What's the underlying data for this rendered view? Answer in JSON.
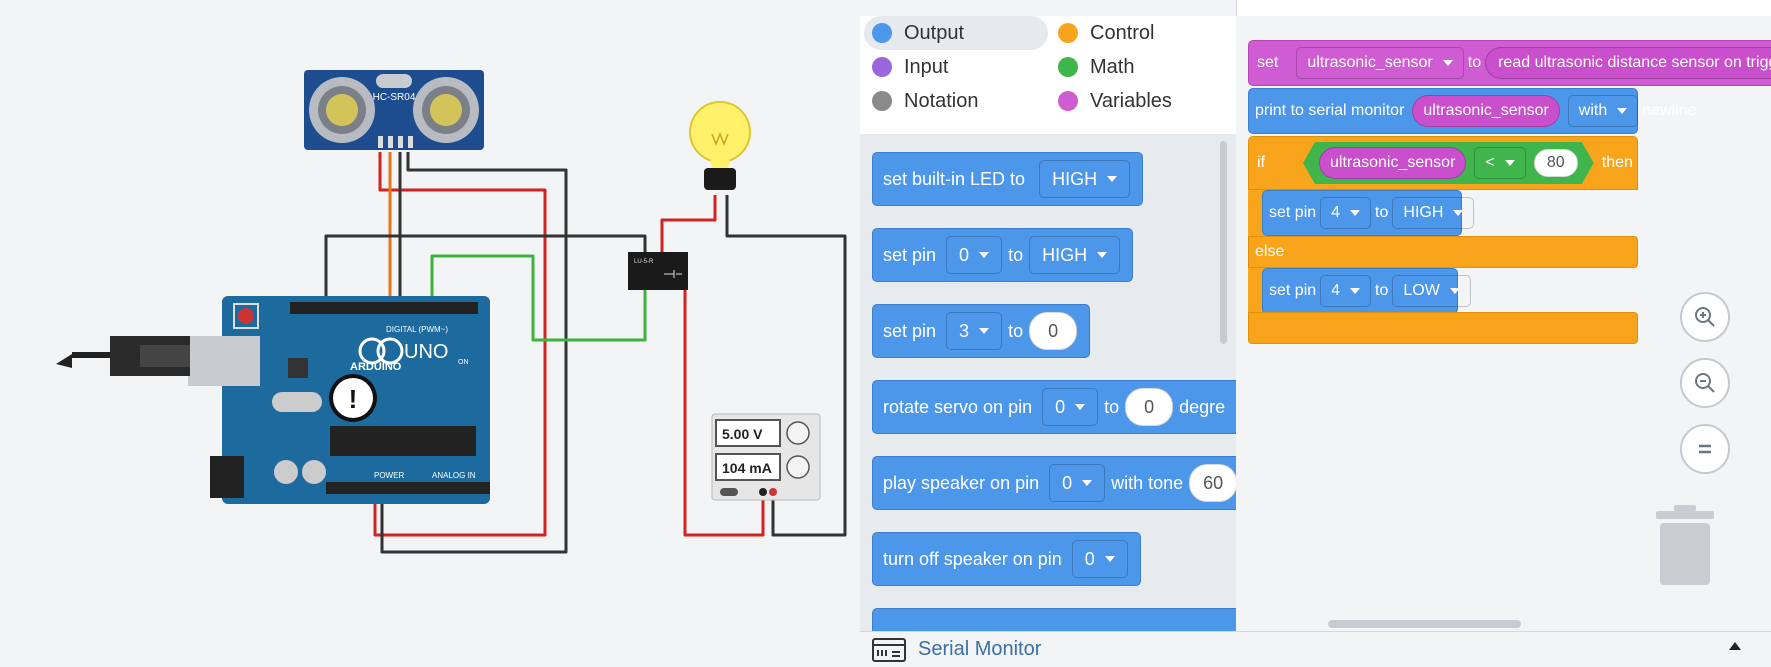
{
  "circuit": {
    "sensor_label": "HC-SR04",
    "board_brand": "ARDUINO",
    "board_model": "UNO",
    "board_header_digital": "DIGITAL (PWM~)",
    "board_header_power": "POWER",
    "board_header_analog": "ANALOG IN",
    "board_on_label": "ON",
    "relay_label": "LU-5-R",
    "supply_voltage": "5.00 V",
    "supply_current": "104 mA",
    "warning_glyph": "!"
  },
  "categories": [
    {
      "label": "Output",
      "color": "#4c97e9",
      "selected": true
    },
    {
      "label": "Control",
      "color": "#f8a51c",
      "selected": false
    },
    {
      "label": "Input",
      "color": "#9966dd",
      "selected": false
    },
    {
      "label": "Math",
      "color": "#3fb54b",
      "selected": false
    },
    {
      "label": "Notation",
      "color": "#8a8a8a",
      "selected": false
    },
    {
      "label": "Variables",
      "color": "#d05cd3",
      "selected": false
    }
  ],
  "toolbox": {
    "b1": {
      "text": "set built-in LED to",
      "dd": "HIGH"
    },
    "b2": {
      "text": "set pin",
      "dd1": "0",
      "to": "to",
      "dd2": "HIGH"
    },
    "b3": {
      "text": "set pin",
      "dd1": "3",
      "to": "to",
      "val": "0"
    },
    "b4": {
      "text": "rotate servo on pin",
      "dd1": "0",
      "to": "to",
      "val": "0",
      "tail": "degre"
    },
    "b5": {
      "text": "play speaker on pin",
      "dd1": "0",
      "mid": "with tone",
      "val": "60"
    },
    "b6": {
      "text": "turn off speaker on pin",
      "dd1": "0"
    }
  },
  "workspace": {
    "set_label": "set",
    "set_var": "ultrasonic_sensor",
    "set_to": "to",
    "set_value": "read ultrasonic distance sensor on trigg",
    "print_label": "print to serial monitor",
    "print_var": "ultrasonic_sensor",
    "print_with": "with",
    "print_newline": "newline",
    "if_label": "if",
    "cond_var": "ultrasonic_sensor",
    "cond_op": "<",
    "cond_val": "80",
    "then_label": "then",
    "then_set": "set pin",
    "then_pin": "4",
    "then_to": "to",
    "then_val": "HIGH",
    "else_label": "else",
    "else_set": "set pin",
    "else_pin": "4",
    "else_to": "to",
    "else_val": "LOW"
  },
  "serial_monitor": {
    "label": "Serial Monitor"
  }
}
